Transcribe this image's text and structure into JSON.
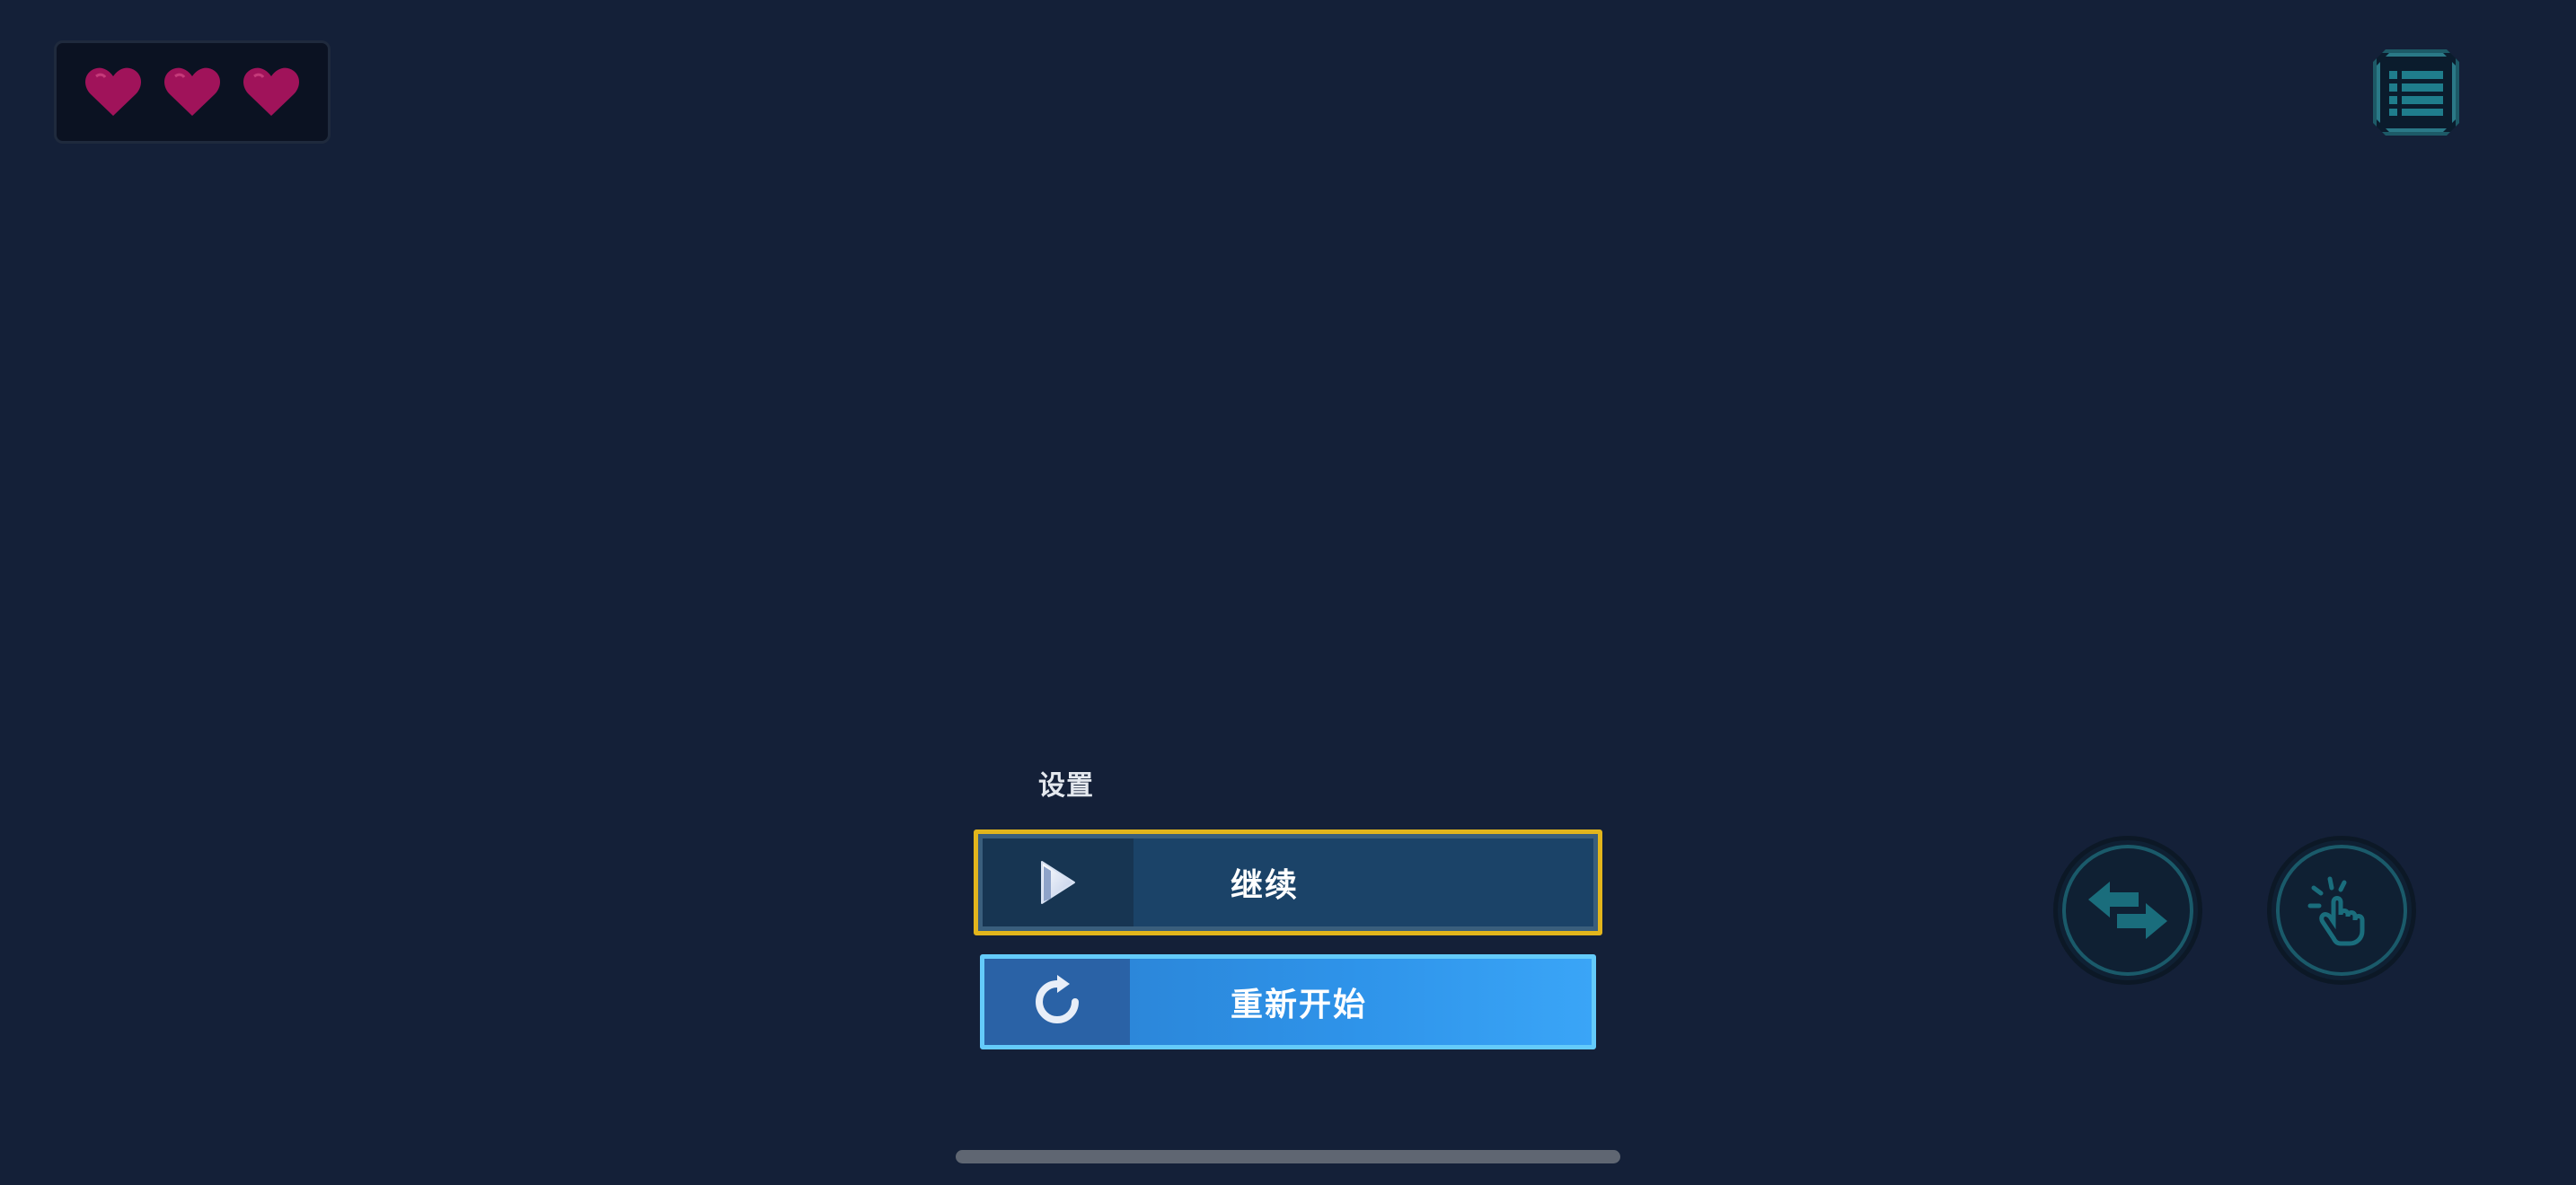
{
  "hud": {
    "lives": {
      "count": 3,
      "max": 3,
      "heart_color": "#a0135a"
    },
    "menu_icon": "list-icon"
  },
  "pause_menu": {
    "title": "设置",
    "options": [
      {
        "label": "继续",
        "icon": "play-icon",
        "selected": true
      },
      {
        "label": "重新开始",
        "icon": "restart-icon",
        "selected": false
      }
    ]
  },
  "controls": {
    "swap_icon": "swap-arrows-icon",
    "tap_icon": "tap-hand-icon"
  },
  "colors": {
    "background": "#142038",
    "selected_border": "#e2b51c",
    "restart_fill": "#2e93e9",
    "accent_teal": "#1a5a6a"
  }
}
